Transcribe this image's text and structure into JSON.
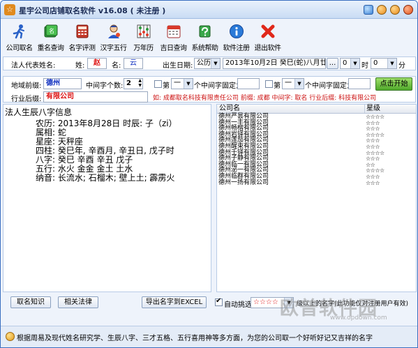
{
  "window": {
    "title": "星宇公司店铺取名软件 v16.08 ( 未注册 )",
    "app_icon": "app-logo-icon"
  },
  "toolbar": [
    {
      "label": "公司取名",
      "icon": "runner-icon"
    },
    {
      "label": "重名查询",
      "icon": "green-book-icon"
    },
    {
      "label": "名字评测",
      "icon": "calculator-icon"
    },
    {
      "label": "汉字五行",
      "icon": "person-icon"
    },
    {
      "label": "万年历",
      "icon": "abacus-icon"
    },
    {
      "label": "吉日查询",
      "icon": "calendar-icon"
    },
    {
      "label": "系统帮助",
      "icon": "help-book-icon"
    },
    {
      "label": "软件注册",
      "icon": "info-icon"
    },
    {
      "label": "退出软件",
      "icon": "exit-x-icon"
    }
  ],
  "legal_rep": {
    "label": "法人代表姓名:",
    "surname_label": "姓:",
    "surname": "赵",
    "given_label": "名:",
    "given": "云"
  },
  "birth": {
    "label": "出生日期:",
    "calendar": "公历",
    "date": "2013年10月2日  癸巳(蛇)八月廿八",
    "picker_button": "...",
    "hour": "0",
    "hour_unit": "时",
    "minute": "0",
    "minute_unit": "分"
  },
  "prefix": {
    "label": "地域前缀:",
    "value": "德州",
    "mid_count_label": "中间字个数:",
    "mid_count": "2"
  },
  "fixed1": {
    "checked": false,
    "prefix": "第",
    "position": "一",
    "suffix": "个中间字固定为",
    "value": ""
  },
  "fixed2": {
    "checked": false,
    "prefix": "第",
    "position": "一",
    "suffix": "个中间字固定为",
    "value": ""
  },
  "start_button": "点击开始",
  "suffix": {
    "label": "行业后缀:",
    "value": "有限公司",
    "example": "如: 成都取名科技有限责任公司    前缀: 成都    中间字: 取名    行业后缀: 科技有限公司"
  },
  "bazi": {
    "title": "法人生辰八字信息",
    "lines": [
      "农历: 2013年8月28日  时辰: 子（zi）",
      "属相: 蛇",
      "星座: 天秤座",
      "四柱: 癸巳年, 辛酉月, 辛丑日, 戊子时",
      "八字: 癸巳 辛酉 辛丑 戊子",
      "五行: 水火 金金 金土 土水",
      "纳音: 长流水; 石榴木; 壁上土; 霹雳火"
    ]
  },
  "results": {
    "col_name": "公司名",
    "col_rating": "星级",
    "rows": [
      {
        "name": "德州严昙有限公司",
        "stars": "☆☆☆☆"
      },
      {
        "name": "德州一丰有限公司",
        "stars": "☆☆☆"
      },
      {
        "name": "德州畅楷有限公司",
        "stars": "☆☆☆"
      },
      {
        "name": "德州岩铎有限公司",
        "stars": "☆☆☆☆"
      },
      {
        "name": "德州莲茄有限公司",
        "stars": "☆☆☆"
      },
      {
        "name": "德州醒束有限公司",
        "stars": "☆☆☆"
      },
      {
        "name": "德州壬铎有限公司",
        "stars": "☆☆☆☆"
      },
      {
        "name": "德州子静有限公司",
        "stars": "☆☆☆"
      },
      {
        "name": "德州临一有限公司",
        "stars": "☆☆"
      },
      {
        "name": "德州泌一有限公司",
        "stars": "☆☆☆☆"
      },
      {
        "name": "德州临群有限公司",
        "stars": "☆☆☆"
      },
      {
        "name": "德州一扬有限公司",
        "stars": "☆☆☆"
      }
    ]
  },
  "bottom": {
    "knowledge_button": "取名知识",
    "law_button": "相关法律",
    "export_button": "导出名字到EXCEL",
    "auto_filter_label": "自动挑选",
    "auto_filter_checked": true,
    "rating_value": "☆☆☆☆",
    "note": "级以上的名字(此功能仅对注册用户有效)"
  },
  "status": {
    "text": "根据周易及现代姓名研究学、生辰八字、三才五格、五行喜用神等多方面，为您的公司取一个好听好记又吉祥的名字"
  },
  "watermark": {
    "text": "欧普软件园",
    "url": "www.opdown.com"
  }
}
